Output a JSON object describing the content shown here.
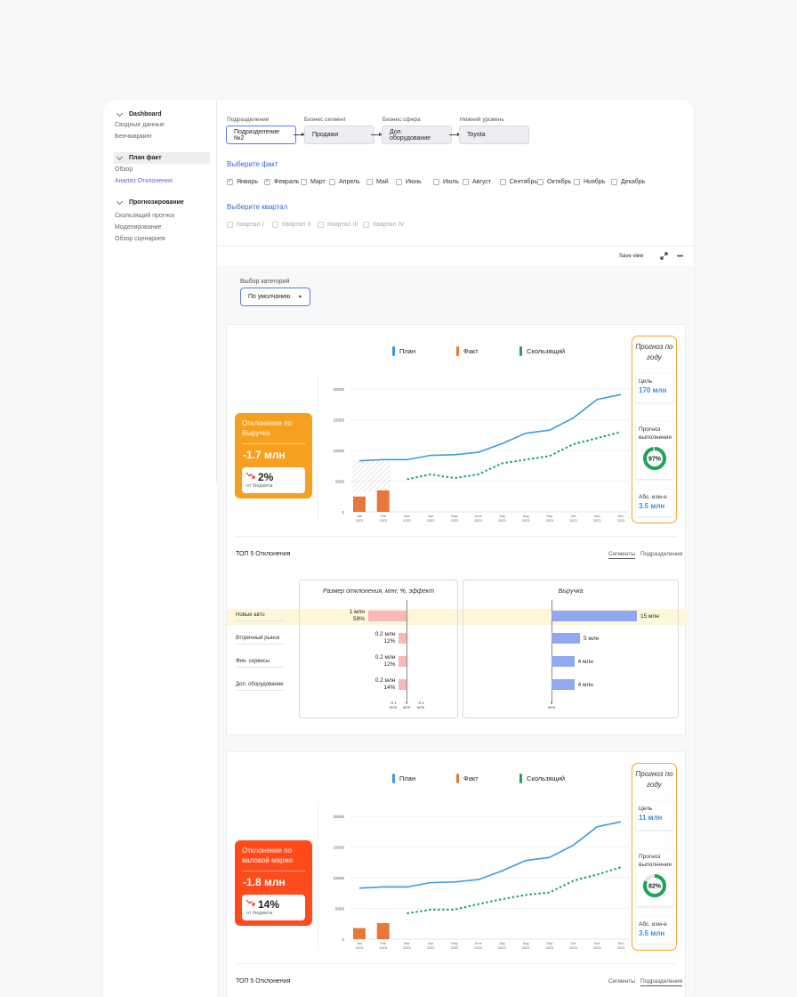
{
  "sidebar": {
    "groups": [
      {
        "title": "Dashboard",
        "items": [
          "Сводные данные",
          "Бенчмаркинг"
        ]
      },
      {
        "title": "План факт",
        "items": [
          "Обзор",
          "Анализ Отклонения"
        ]
      },
      {
        "title": "Прогнозирование",
        "items": [
          "Скользящий прогноз",
          "Моделирование",
          "Обзор сценариев"
        ]
      }
    ]
  },
  "filters": {
    "labels": [
      "Подразделение",
      "Бизнес сегмент",
      "Бизнес сфера",
      "Нижний уровень"
    ],
    "values": [
      "Подразделение №2",
      "Продажи",
      "Доп. оборудование",
      "Toyota"
    ]
  },
  "facts": {
    "title": "Выберите факт",
    "months": [
      "Январь",
      "Февраль",
      "Март",
      "Апрель",
      "Май",
      "Июнь",
      "Июль",
      "Август",
      "Сентябрь",
      "Октябрь",
      "Ноябрь",
      "Декабрь"
    ],
    "checked": [
      true,
      true,
      false,
      false,
      false,
      false,
      false,
      false,
      false,
      false,
      false,
      false
    ]
  },
  "quarters": {
    "title": "Выберите квартал",
    "items": [
      "Квартал I",
      "Квартал II",
      "Квартал III",
      "Квартал IV"
    ]
  },
  "toolbar": {
    "save_view": "Save view"
  },
  "category": {
    "label": "Выбор категорий",
    "value": "По умолчанию"
  },
  "legend": {
    "plan": "План",
    "fact": "Факт",
    "rolling": "Скользящий"
  },
  "colors": {
    "plan": "#3b9be0",
    "fact": "#e8773a",
    "rolling": "#1aa55a",
    "revenue_card": "#f7a020",
    "margin_card": "#ff4a1c",
    "neg_bar": "#f9b8b8",
    "rev_bar": "#8ea8f2",
    "highlight": "#fdf6d8"
  },
  "cards": [
    {
      "deviation": {
        "title": "Отклонение по Выручке",
        "value": "-1.7 млн",
        "pct": "2%",
        "pct_label": "от бюджета"
      },
      "forecast": {
        "title": "Прогноз по году",
        "goal_label": "Цель",
        "goal": "170 млн",
        "exec_label": "Прогноз выполнения",
        "exec_pct": 97,
        "exec_text": "97%",
        "abs_label": "Абс. изм-е",
        "abs": "3.5 млн"
      },
      "chart_data": {
        "type": "line",
        "x": [
          "Jan\n2023",
          "Feb\n2023",
          "Mar\n2023",
          "Apr\n2023",
          "May\n2023",
          "June\n2023",
          "July\n2023",
          "Aug\n2023",
          "Sep\n2023",
          "Oct\n2023",
          "Nov\n2023",
          "Dec\n2023"
        ],
        "yticks": [
          0,
          5000,
          10000,
          15000,
          20000
        ],
        "ylim": [
          0,
          20000
        ],
        "series": [
          {
            "name": "План",
            "kind": "line",
            "values": [
              8300,
              8500,
              8500,
              9200,
              9300,
              9700,
              11100,
              12800,
              13300,
              15300,
              18300,
              19100
            ]
          },
          {
            "name": "Факт",
            "kind": "bar",
            "values": [
              2500,
              3500,
              null,
              null,
              null,
              null,
              null,
              null,
              null,
              null,
              null,
              null
            ]
          },
          {
            "name": "Скользящий",
            "kind": "dashed",
            "values": [
              null,
              null,
              5300,
              6100,
              5500,
              6100,
              7900,
              8500,
              9100,
              11000,
              12000,
              13000
            ]
          }
        ],
        "hatched_until": 1
      },
      "top5": {
        "title": "ТОП 5 Отклонения",
        "tabs": [
          "Сегменты",
          "Подразделения"
        ],
        "active_tab": 0,
        "rows": [
          "Новые авто",
          "Вторичный рынок",
          "Фин. сервисы",
          "Доп. оборудование"
        ],
        "deviation_panel": {
          "title": "Размер отклонения, млн; %, эффект",
          "labels": [
            [
              "1 млн",
              "59%"
            ],
            [
              "0.2 млн",
              "12%"
            ],
            [
              "0.2 млн",
              "12%"
            ],
            [
              "0.2 млн",
              "14%"
            ]
          ],
          "values": [
            -1,
            -0.2,
            -0.2,
            -0.2
          ],
          "axis": [
            "-0.1\nмлн",
            "0\nмлн",
            "-0.1\nмлн"
          ]
        },
        "revenue_panel": {
          "title": "Выручка",
          "labels": [
            "15 млн",
            "5 млн",
            "4 млн",
            "4 млн"
          ],
          "values": [
            15,
            5,
            4,
            4
          ],
          "axis": "0\nмлн"
        }
      }
    },
    {
      "deviation": {
        "title": "Отклонение по валовой марже",
        "value": "-1.8 млн",
        "pct": "14%",
        "pct_label": "от бюджета"
      },
      "forecast": {
        "title": "Прогноз по году",
        "goal_label": "Цель",
        "goal": "11 млн",
        "exec_label": "Прогноз выполнения",
        "exec_pct": 82,
        "exec_text": "82%",
        "abs_label": "Абс. изм-е",
        "abs": "3.5 млн"
      },
      "chart_data": {
        "type": "line",
        "x": [
          "Jan\n2023",
          "Feb\n2023",
          "Mar\n2023",
          "Apr\n2023",
          "May\n2023",
          "June\n2023",
          "July\n2023",
          "Aug\n2023",
          "Sep\n2023",
          "Oct\n2023",
          "Nov\n2023",
          "Dec\n2023"
        ],
        "yticks": [
          0,
          5000,
          10000,
          15000,
          20000
        ],
        "ylim": [
          0,
          20000
        ],
        "series": [
          {
            "name": "План",
            "kind": "line",
            "values": [
              8300,
              8500,
              8500,
              9200,
              9300,
              9700,
              11100,
              12800,
              13300,
              15300,
              18300,
              19100
            ]
          },
          {
            "name": "Факт",
            "kind": "bar",
            "values": [
              1800,
              2600,
              null,
              null,
              null,
              null,
              null,
              null,
              null,
              null,
              null,
              null
            ]
          },
          {
            "name": "Скользящий",
            "kind": "dashed",
            "values": [
              null,
              null,
              4200,
              4800,
              4800,
              5700,
              6500,
              7200,
              7600,
              9500,
              10500,
              11700
            ]
          }
        ],
        "hatched_until": null
      },
      "top5": {
        "title": "ТОП 5 Отклонения",
        "tabs": [
          "Сегменты",
          "Подразделения"
        ],
        "active_tab": 1
      }
    }
  ]
}
